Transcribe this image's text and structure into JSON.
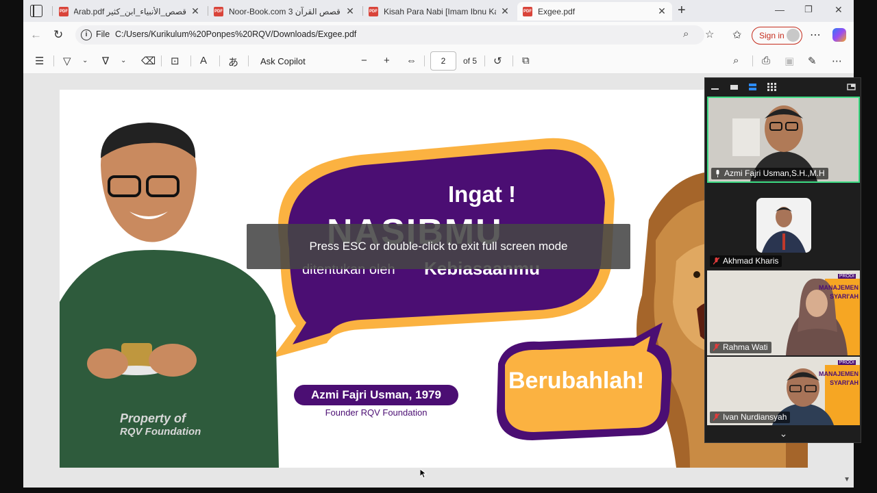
{
  "tabs": [
    {
      "title": "قصص_الأنبياء_ابن_كثير Arab.pdf",
      "active": false
    },
    {
      "title": "Noor-Book.com قصص القرآن 3 .pdf",
      "active": false
    },
    {
      "title": "Kisah Para Nabi [Imam Ibnu Katsir]",
      "active": false
    },
    {
      "title": "Exgee.pdf",
      "active": true
    }
  ],
  "address": {
    "scheme_label": "File",
    "url": "C:/Users/Kurikulum%20Ponpes%20RQV/Downloads/Exgee.pdf",
    "sign_in_label": "Sign in"
  },
  "pdf_toolbar": {
    "ask_copilot_label": "Ask Copilot",
    "current_page": "2",
    "page_of_label": "of 5"
  },
  "slide": {
    "headline": "Ingat !",
    "big_word": "NASIBMU",
    "line_prefix": "ditentukan oleh",
    "line_emphasis": "Kebiasaanmu",
    "call_to_action": "Berubahlah!",
    "author": "Azmi Fajri Usman, 1979",
    "author_role": "Founder RQV Foundation",
    "watermark_line1": "Property of",
    "watermark_line2": "RQV Foundation"
  },
  "fullscreen_notice": "Press ESC or double-click to exit full screen mode",
  "zoom": {
    "participants": [
      {
        "name": "Azmi Fajri Usman,S.H.,M.H",
        "speaking": true,
        "muted": false
      },
      {
        "name": "Akhmad Kharis",
        "speaking": false,
        "muted": true
      },
      {
        "name": "Rahma Wati",
        "speaking": false,
        "muted": true
      },
      {
        "name": "Ivan Nurdiansyah",
        "speaking": false,
        "muted": true
      }
    ],
    "tile_texts": {
      "prodi": "PRODI",
      "manajemen": "MANAJEMEN",
      "syariah": "SYARI'AH"
    }
  },
  "colors": {
    "purple": "#4b0e73",
    "orange": "#fbb241",
    "speaker_border": "#3ddc84",
    "mute_red": "#e03b3b"
  }
}
